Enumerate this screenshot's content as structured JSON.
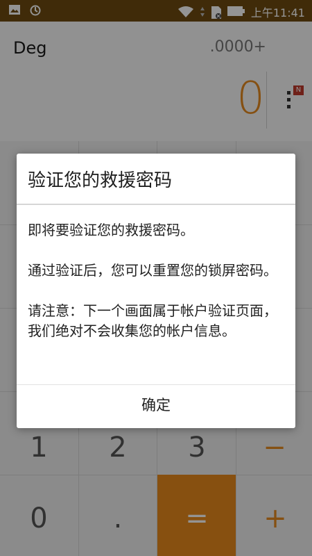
{
  "status_bar": {
    "time": "上午11:41",
    "icons": [
      "image-notification-icon",
      "sync-notification-icon",
      "wifi-icon",
      "data-arrows-icon",
      "sim-icon",
      "battery-icon"
    ]
  },
  "calculator": {
    "angle_mode": "Deg",
    "precision": ".0000+",
    "result": "0",
    "badge": "N",
    "keys_visible": {
      "row4": [
        "1",
        "2",
        "3",
        "−"
      ],
      "row5": [
        "0",
        ".",
        "=",
        "+"
      ]
    },
    "accent_color": "#e88a1c"
  },
  "dialog": {
    "title": "验证您的救援密码",
    "body": [
      "即将要验证您的救援密码。",
      "通过验证后，您可以重置您的锁屏密码。",
      "请注意：下一个画面属于帐户验证页面，我们绝对不会收集您的帐户信息。"
    ],
    "confirm": "确定"
  }
}
